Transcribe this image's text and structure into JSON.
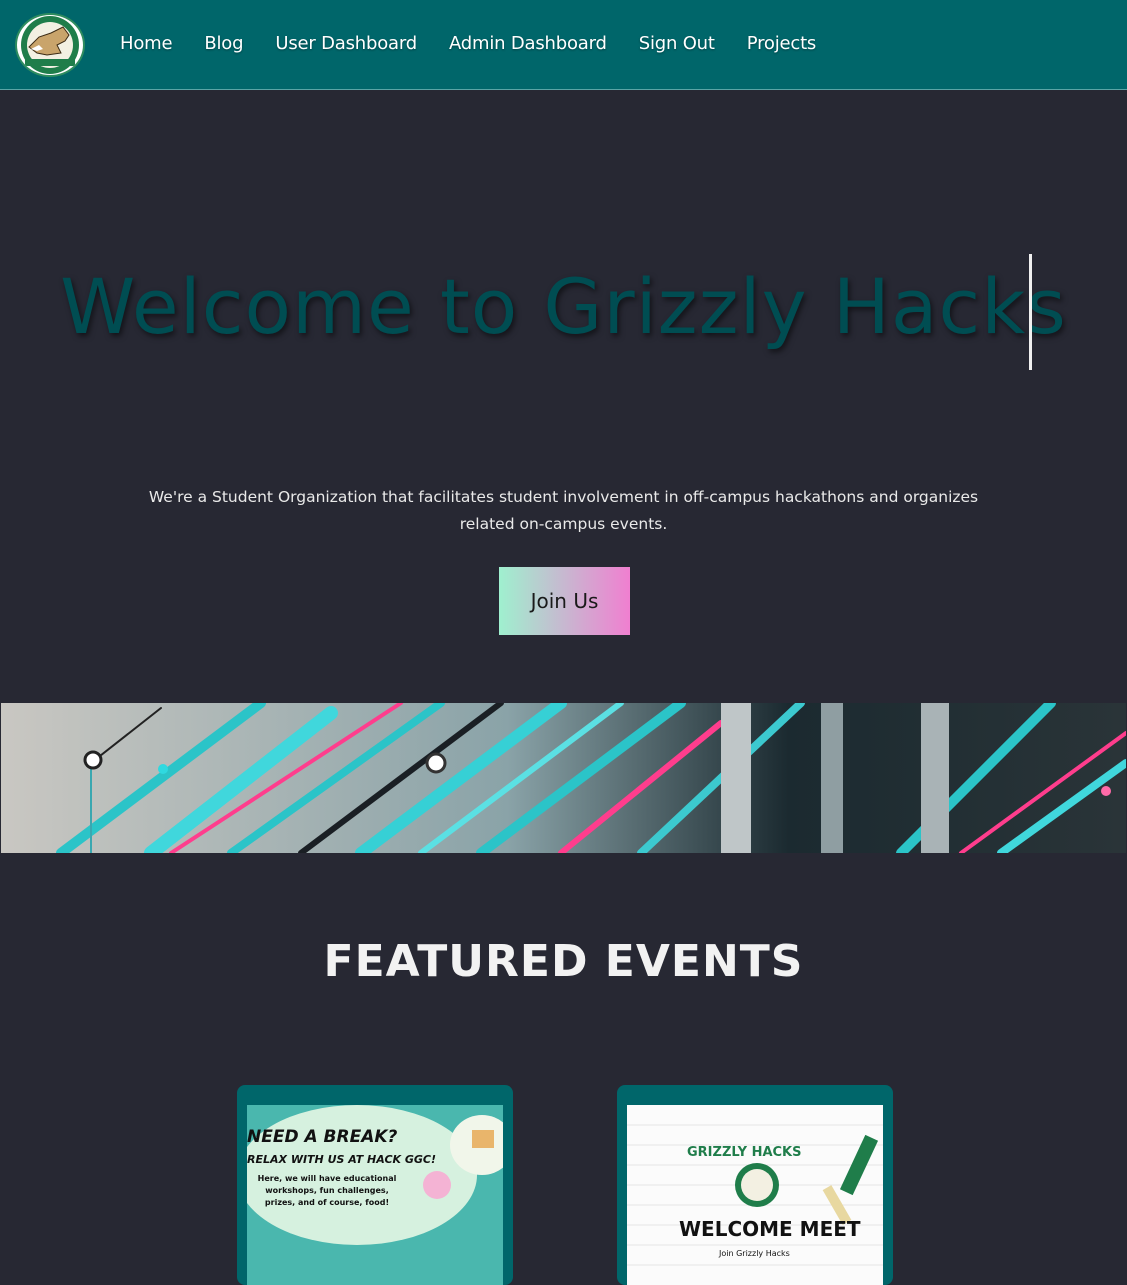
{
  "nav": {
    "logo_alt": "Grizzly Hacks",
    "links": [
      {
        "label": "Home"
      },
      {
        "label": "Blog"
      },
      {
        "label": "User Dashboard"
      },
      {
        "label": "Admin Dashboard"
      },
      {
        "label": "Sign Out"
      },
      {
        "label": "Projects"
      }
    ]
  },
  "hero": {
    "title": "Welcome to Grizzly Hacks",
    "tagline": "We're a Student Organization that facilitates student involvement in off-campus hackathons and organizes related on-campus events.",
    "cta_label": "Join Us"
  },
  "events": {
    "heading": "FEATURED EVENTS",
    "cards": [
      {
        "headline": "NEED A BREAK?",
        "subhead": "RELAX WITH US AT HACK GGC!",
        "body": "Here, we will have educational workshops, fun challenges, prizes, and of course, food!"
      },
      {
        "brand": "GRIZZLY HACKS",
        "headline": "WELCOME MEET",
        "subhead": "Join Grizzly Hacks"
      }
    ]
  },
  "colors": {
    "nav_bg": "#00666a",
    "page_bg": "#272833",
    "title_color": "#004d52",
    "cta_gradient_start": "#9ff0cf",
    "cta_gradient_end": "#f07fd0"
  }
}
